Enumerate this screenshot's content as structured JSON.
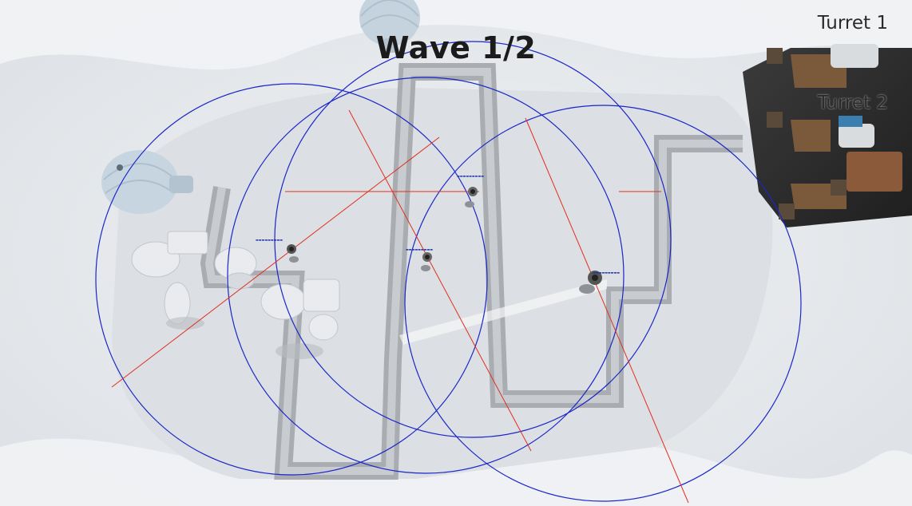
{
  "hud": {
    "wave_text": "Wave 1/2"
  },
  "build_menu": {
    "turret_1_label": "Turret 1",
    "turret_2_label": "Turret 2"
  },
  "colors": {
    "range_circle": "#1a26c8",
    "target_line": "#e0301e",
    "snow": "#e9ecef",
    "path": "#a9acb0"
  },
  "turrets": [
    {
      "name": "turret-left",
      "target_line": true
    },
    {
      "name": "turret-center",
      "target_line": true
    },
    {
      "name": "turret-center-low",
      "target_line": true
    },
    {
      "name": "turret-right",
      "target_line": true
    }
  ]
}
